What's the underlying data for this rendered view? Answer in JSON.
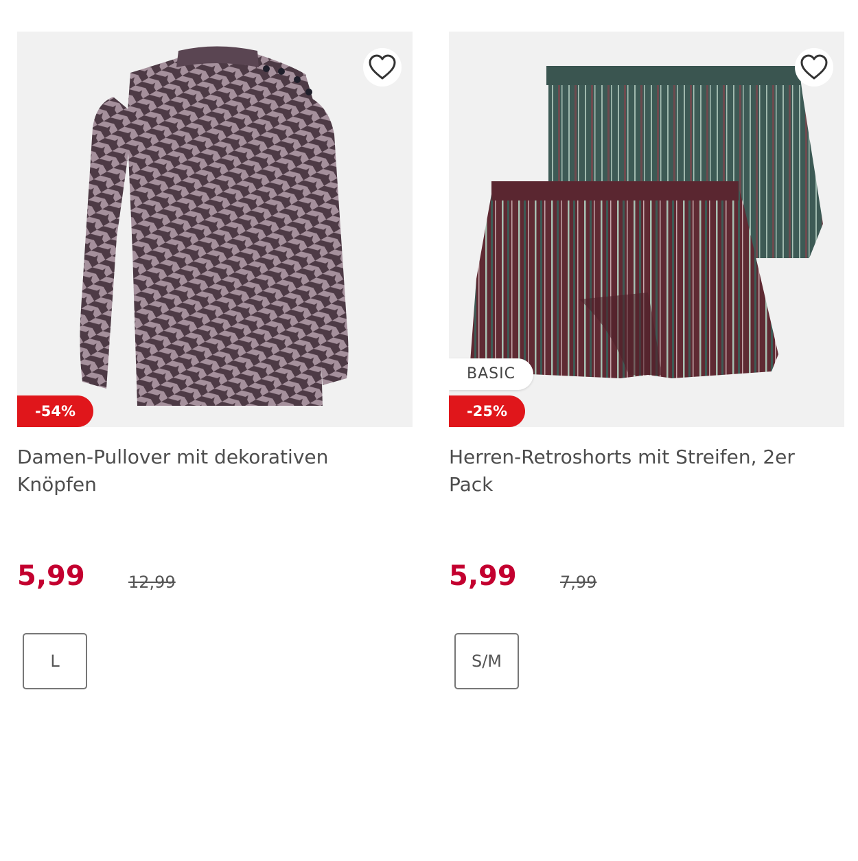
{
  "products": [
    {
      "title": "Damen-Pullover mit dekorativen Knöpfen",
      "price": "5,99",
      "old_price": "12,99",
      "discount": "-54%",
      "badge": "",
      "size": "L",
      "favorite_icon": "heart-outline-icon"
    },
    {
      "title": "Herren-Retroshorts mit Streifen, 2er Pack",
      "price": "5,99",
      "old_price": "7,99",
      "discount": "-25%",
      "badge": "BASIC",
      "size": "S/M",
      "favorite_icon": "heart-outline-icon"
    }
  ],
  "colors": {
    "price": "#c3002f",
    "discount_badge": "#e0161b",
    "image_background": "#f1f1f1"
  }
}
